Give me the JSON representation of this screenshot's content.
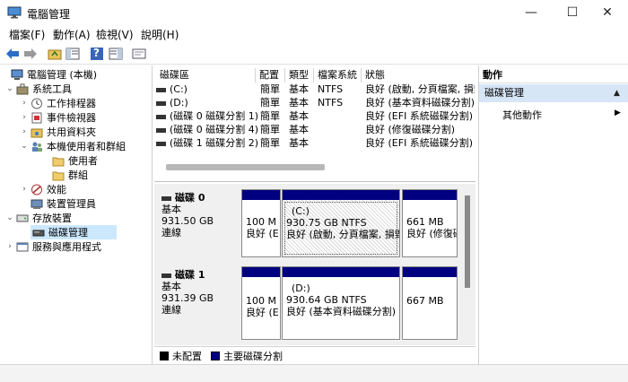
{
  "window": {
    "title": "電腦管理",
    "minimize_glyph": "—",
    "maximize_glyph": "☐",
    "close_glyph": "✕"
  },
  "menu": [
    "檔案(F)",
    "動作(A)",
    "檢視(V)",
    "說明(H)"
  ],
  "toolbar": {
    "icons": [
      "back-arrow-icon",
      "forward-arrow-icon",
      "up-folder-icon",
      "show-tree-icon",
      "help-icon",
      "show-action-pane-icon",
      "properties-icon"
    ],
    "help_glyph": "?"
  },
  "tree": {
    "root": "電腦管理 (本機)",
    "system_tools": "系統工具",
    "task_scheduler": "工作排程器",
    "event_viewer": "事件檢視器",
    "shared_folders": "共用資料夾",
    "local_users": "本機使用者和群組",
    "users": "使用者",
    "groups": "群組",
    "performance": "效能",
    "device_manager": "裝置管理員",
    "storage": "存放裝置",
    "disk_management": "磁碟管理",
    "services": "服務與應用程式",
    "chevron_right": "›",
    "chevron_down": "⌄"
  },
  "volume_list": {
    "headers": [
      "磁碟區",
      "配置",
      "類型",
      "檔案系統",
      "狀態"
    ],
    "rows": [
      [
        "(C:)",
        "簡單",
        "基本",
        "NTFS",
        "良好 (啟動, 分頁檔案, 損毀"
      ],
      [
        "(D:)",
        "簡單",
        "基本",
        "NTFS",
        "良好 (基本資料磁碟分割)"
      ],
      [
        "(磁碟 0 磁碟分割 1)",
        "簡單",
        "基本",
        "",
        "良好 (EFI 系統磁碟分割)"
      ],
      [
        "(磁碟 0 磁碟分割 4)",
        "簡單",
        "基本",
        "",
        "良好 (修復磁碟分割)"
      ],
      [
        "(磁碟 1 磁碟分割 2)",
        "簡單",
        "基本",
        "",
        "良好 (EFI 系統磁碟分割)"
      ]
    ]
  },
  "disks": [
    {
      "name": "磁碟 0",
      "type": "基本",
      "size": "931.50 GB",
      "status": "連線",
      "partitions": [
        {
          "line1": "100 M",
          "line2": "良好 (E"
        },
        {
          "label": "(C:)",
          "line1": "930.75 GB NTFS",
          "line2": "良好 (啟動, 分頁檔案, 損毀"
        },
        {
          "line1": "661 MB",
          "line2": "良好 (修復磁"
        }
      ]
    },
    {
      "name": "磁碟 1",
      "type": "基本",
      "size": "931.39 GB",
      "status": "連線",
      "partitions": [
        {
          "line1": "100 M",
          "line2": "良好 (E"
        },
        {
          "label": "(D:)",
          "line1": "930.64 GB NTFS",
          "line2": "良好 (基本資料磁碟分割)"
        },
        {
          "line1": "667 MB",
          "line2": ""
        }
      ]
    }
  ],
  "legend": [
    {
      "label": "未配置",
      "color": "#000000"
    },
    {
      "label": "主要磁碟分割",
      "color": "#000080"
    }
  ],
  "actions": {
    "header": "動作",
    "section": "磁碟管理",
    "more": "其他動作",
    "collapse_glyph": "▲",
    "more_glyph": "▶"
  },
  "colors": {
    "accent": "#000080",
    "selection": "#cce8ff",
    "action_header": "#d7e6f7"
  }
}
